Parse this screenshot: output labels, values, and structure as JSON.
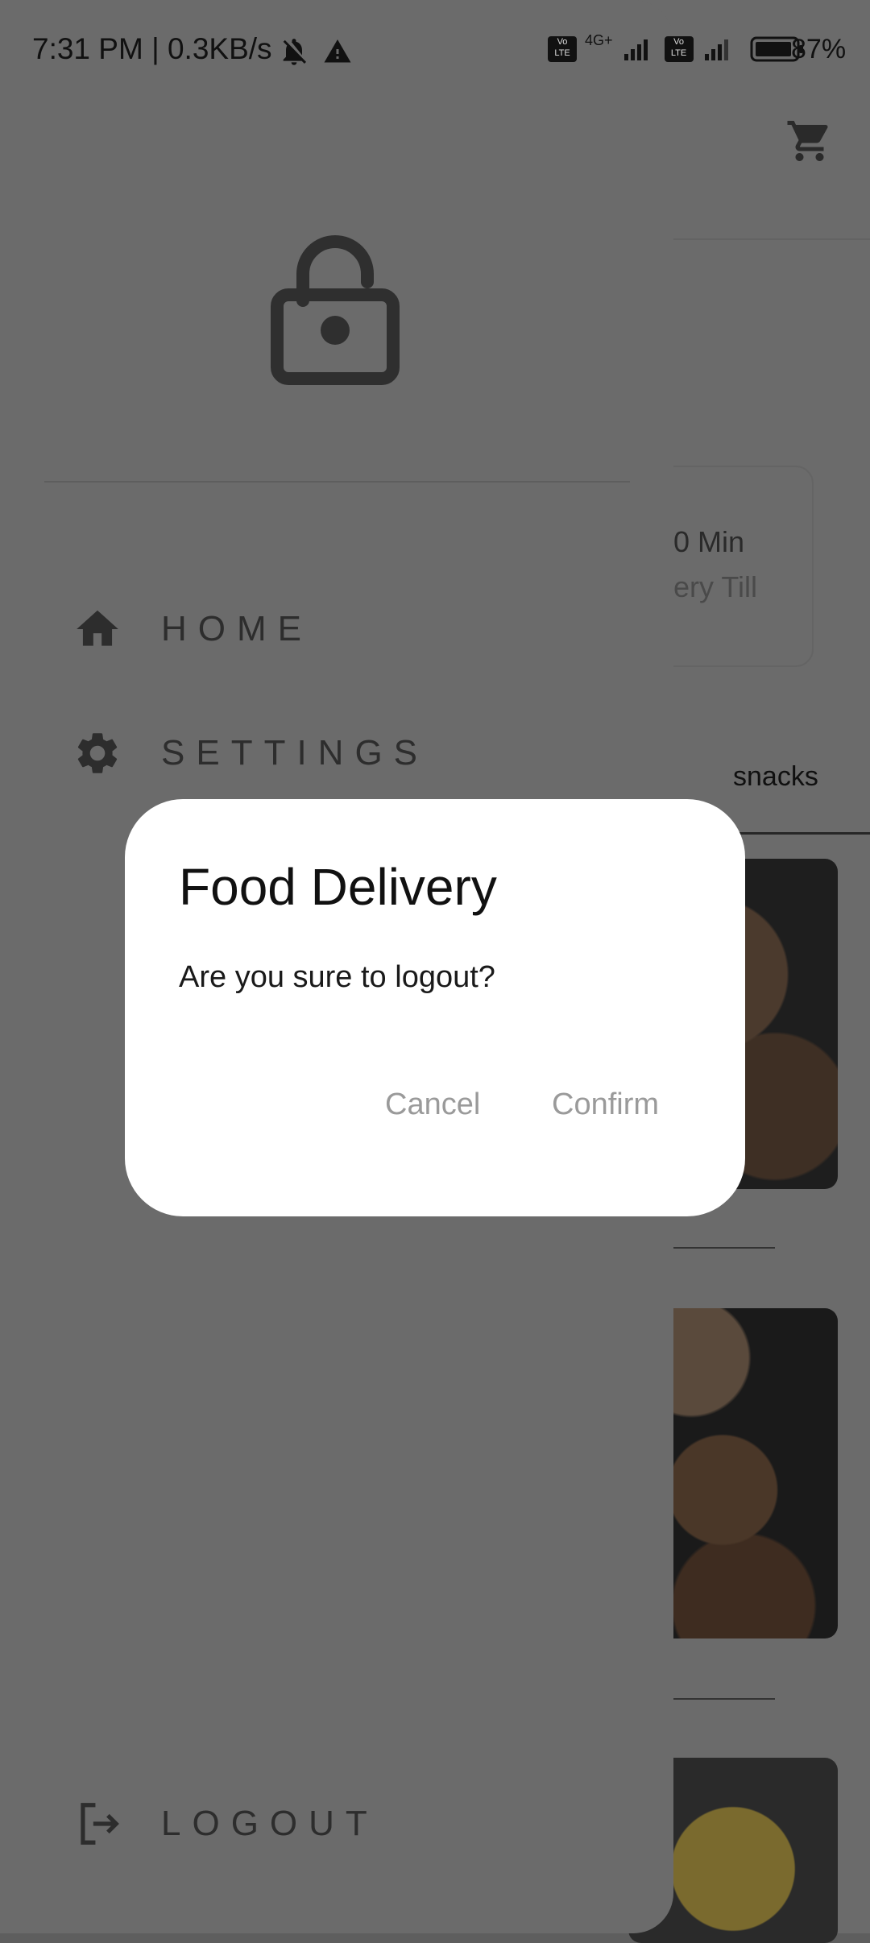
{
  "status_bar": {
    "time_speed": "7:31 PM | 0.3KB/s",
    "network": "4G+",
    "battery": "87%"
  },
  "background_page": {
    "offer_line1": "0 Min",
    "offer_line2": "ery Till",
    "tab_label": "snacks"
  },
  "drawer": {
    "items": [
      {
        "label": "HOME",
        "icon": "home-icon"
      },
      {
        "label": "SETTINGS",
        "icon": "gear-icon"
      }
    ],
    "logout": {
      "label": "LOGOUT",
      "icon": "logout-icon"
    }
  },
  "dialog": {
    "title": "Food Delivery",
    "message": "Are you sure to logout?",
    "cancel_label": "Cancel",
    "confirm_label": "Confirm"
  },
  "colors": {
    "scrim": "#6b6b6b",
    "dialog_bg": "#ffffff",
    "dialog_button_text": "#9a9a9a"
  }
}
